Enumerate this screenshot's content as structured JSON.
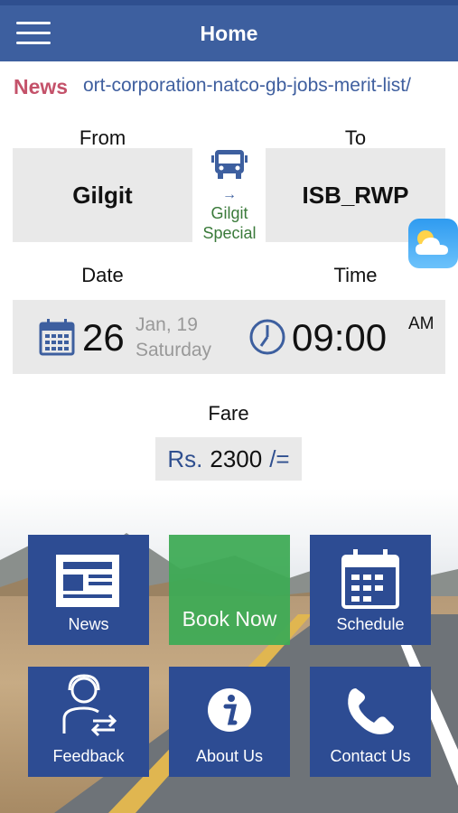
{
  "header": {
    "title": "Home",
    "menu_icon": "hamburger-menu-icon"
  },
  "ticker": {
    "label": "News",
    "text": "ort-corporation-natco-gb-jobs-merit-list/"
  },
  "route": {
    "from_label": "From",
    "to_label": "To",
    "from": "Gilgit",
    "to": "ISB_RWP",
    "bus_arrow": "→",
    "bus_service": [
      "Gilgit",
      "Special"
    ]
  },
  "schedule": {
    "date_label": "Date",
    "time_label": "Time",
    "day": "26",
    "month_year": "Jan, 19",
    "weekday": "Saturday",
    "time": "09:00",
    "ampm": "AM"
  },
  "fare": {
    "label": "Fare",
    "currency": "Rs.",
    "amount": "2300",
    "suffix": "/="
  },
  "tiles": {
    "news": "News",
    "book": "Book Now",
    "schedule": "Schedule",
    "feedback": "Feedback",
    "about": "About Us",
    "contact": "Contact Us"
  },
  "colors": {
    "primary": "#3d5f9f",
    "tile": "#2d4c93",
    "book": "#3fab56",
    "news_label": "#c4526a"
  }
}
